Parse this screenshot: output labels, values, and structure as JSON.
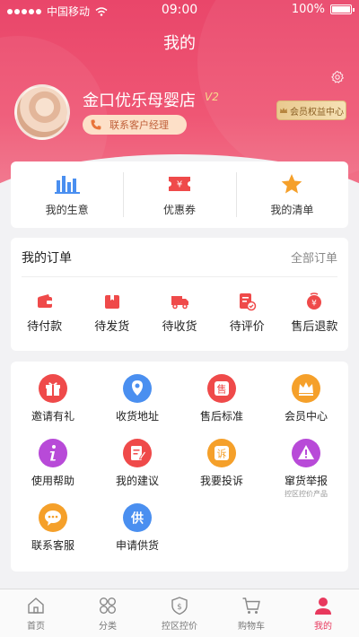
{
  "status_bar": {
    "carrier": "中国移动",
    "time": "09:00",
    "battery": "100%"
  },
  "page": {
    "title": "我的"
  },
  "profile": {
    "shop_name": "金口优乐母婴店",
    "vip_level": "V2",
    "contact_manager": "联系客户经理",
    "member_center": "会员权益中心"
  },
  "quick_links": [
    {
      "label": "我的生意",
      "icon": "bar-chart-icon"
    },
    {
      "label": "优惠券",
      "icon": "coupon-icon"
    },
    {
      "label": "我的清单",
      "icon": "star-icon"
    }
  ],
  "orders": {
    "title": "我的订单",
    "all_label": "全部订单",
    "items": [
      {
        "label": "待付款",
        "icon": "wallet-icon"
      },
      {
        "label": "待发货",
        "icon": "box-icon"
      },
      {
        "label": "待收货",
        "icon": "truck-icon"
      },
      {
        "label": "待评价",
        "icon": "review-icon"
      },
      {
        "label": "售后退款",
        "icon": "refund-icon"
      }
    ]
  },
  "services": [
    {
      "label": "邀请有礼",
      "icon": "gift-icon",
      "color": "#ef4a4a"
    },
    {
      "label": "收货地址",
      "icon": "location-icon",
      "color": "#4a8ff0"
    },
    {
      "label": "售后标准",
      "icon": "aftersale-icon",
      "color": "#ef4a4a",
      "glyph": "售"
    },
    {
      "label": "会员中心",
      "icon": "crown-icon",
      "color": "#f5a02a"
    },
    {
      "label": "使用帮助",
      "icon": "info-icon",
      "color": "#b84ad8"
    },
    {
      "label": "我的建议",
      "icon": "suggestion-icon",
      "color": "#ef4a4a"
    },
    {
      "label": "我要投诉",
      "icon": "complaint-icon",
      "color": "#f5a02a",
      "glyph": "诉"
    },
    {
      "label": "窜货举报",
      "sub": "控区控价产品",
      "icon": "warning-icon",
      "color": "#b84ad8"
    },
    {
      "label": "联系客服",
      "icon": "chat-icon",
      "color": "#f5a02a"
    },
    {
      "label": "申请供货",
      "icon": "supply-icon",
      "color": "#4a8ff0",
      "glyph": "供"
    }
  ],
  "tabbar": [
    {
      "label": "首页",
      "icon": "home-icon"
    },
    {
      "label": "分类",
      "icon": "category-icon"
    },
    {
      "label": "控区控价",
      "icon": "price-shield-icon"
    },
    {
      "label": "购物车",
      "icon": "cart-icon"
    },
    {
      "label": "我的",
      "icon": "profile-icon",
      "active": true
    }
  ],
  "colors": {
    "brand": "#e8385d",
    "accent_gold": "#dcb577",
    "orange": "#f5a02a",
    "blue": "#4a8ff0",
    "purple": "#b84ad8"
  }
}
